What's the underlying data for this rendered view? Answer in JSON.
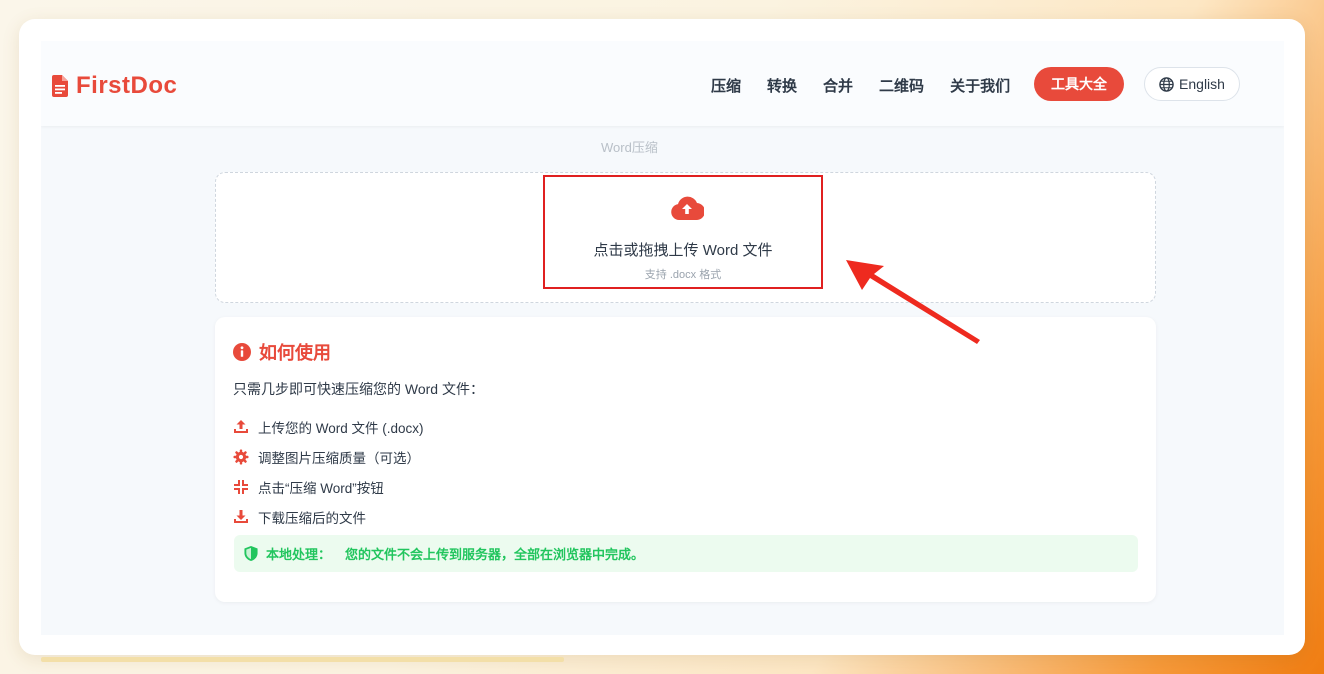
{
  "brand": {
    "name": "FirstDoc",
    "accent": "#e84a3b"
  },
  "nav": {
    "links": [
      "压缩",
      "转换",
      "合并",
      "二维码",
      "关于我们"
    ],
    "tools_button": "工具大全",
    "language_button": "English"
  },
  "page": {
    "subtitle": "Word压缩"
  },
  "upload": {
    "title": "点击或拖拽上传 Word 文件",
    "hint": "支持 .docx 格式",
    "icon": "cloud-upload-icon"
  },
  "how_to": {
    "title": "如何使用",
    "intro": "只需几步即可快速压缩您的 Word 文件：",
    "steps": [
      {
        "icon": "upload-icon",
        "text": "上传您的 Word 文件 (.docx)"
      },
      {
        "icon": "gear-icon",
        "text": "调整图片压缩质量（可选）"
      },
      {
        "icon": "compress-icon",
        "text": "点击“压缩 Word”按钮"
      },
      {
        "icon": "download-icon",
        "text": "下载压缩后的文件"
      }
    ],
    "notice": {
      "label": "本地处理：",
      "message": "您的文件不会上传到服务器，全部在浏览器中完成。",
      "color": "#22c55e"
    }
  },
  "annotation": {
    "highlight_color": "#e02020"
  }
}
